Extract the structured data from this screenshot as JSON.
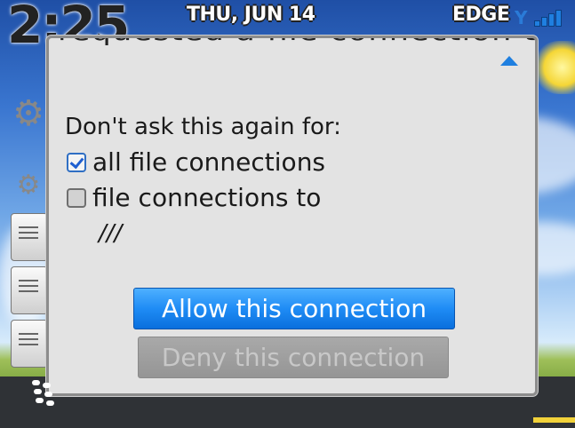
{
  "status_bar": {
    "time": "2:25",
    "date": "THU, JUN 14",
    "network": "EDGE"
  },
  "dialog": {
    "cut_off_text": "requested a file connection to ///.",
    "prompt": "Don't ask this again for:",
    "options": [
      {
        "label": "all file connections",
        "checked": true
      },
      {
        "label": "file connections to",
        "checked": false
      }
    ],
    "path": "///",
    "allow_button": "Allow this connection",
    "deny_button": "Deny this connection"
  },
  "colors": {
    "accent": "#1f8cf5",
    "dialog_bg": "#e3e3e3"
  },
  "icons": [
    "signal-icon",
    "app-icons",
    "launcher-icon",
    "scroll-up-arrow-icon",
    "checkbox-icon"
  ]
}
